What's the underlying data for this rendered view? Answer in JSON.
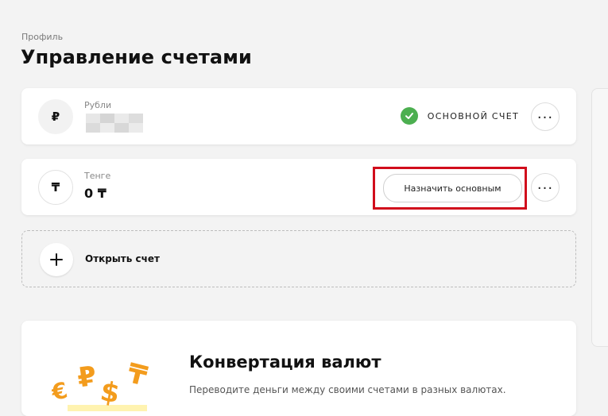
{
  "breadcrumb": "Профиль",
  "page_title": "Управление счетами",
  "accounts": [
    {
      "currency_symbol": "₽",
      "name": "Рубли",
      "status_label": "ОСНОВНОЙ СЧЕТ",
      "more_symbol": "..."
    },
    {
      "currency_symbol": "₸",
      "name": "Тенге",
      "balance": "0 ₸",
      "action_label": "Назначить основным",
      "more_symbol": "..."
    }
  ],
  "open_account": {
    "label": "Открыть счет"
  },
  "promo": {
    "title": "Конвертация валют",
    "text": "Переводите деньги между своими счетами в разных валютах.",
    "art_symbols": [
      "€",
      "₽",
      "$",
      "₸"
    ]
  },
  "colors": {
    "check_green": "#4caf50",
    "highlight_red": "#d10d1c",
    "art_orange": "#f39c1d"
  },
  "icons": [
    "ruble-icon",
    "tenge-icon",
    "check-icon",
    "more-icon",
    "plus-icon"
  ]
}
